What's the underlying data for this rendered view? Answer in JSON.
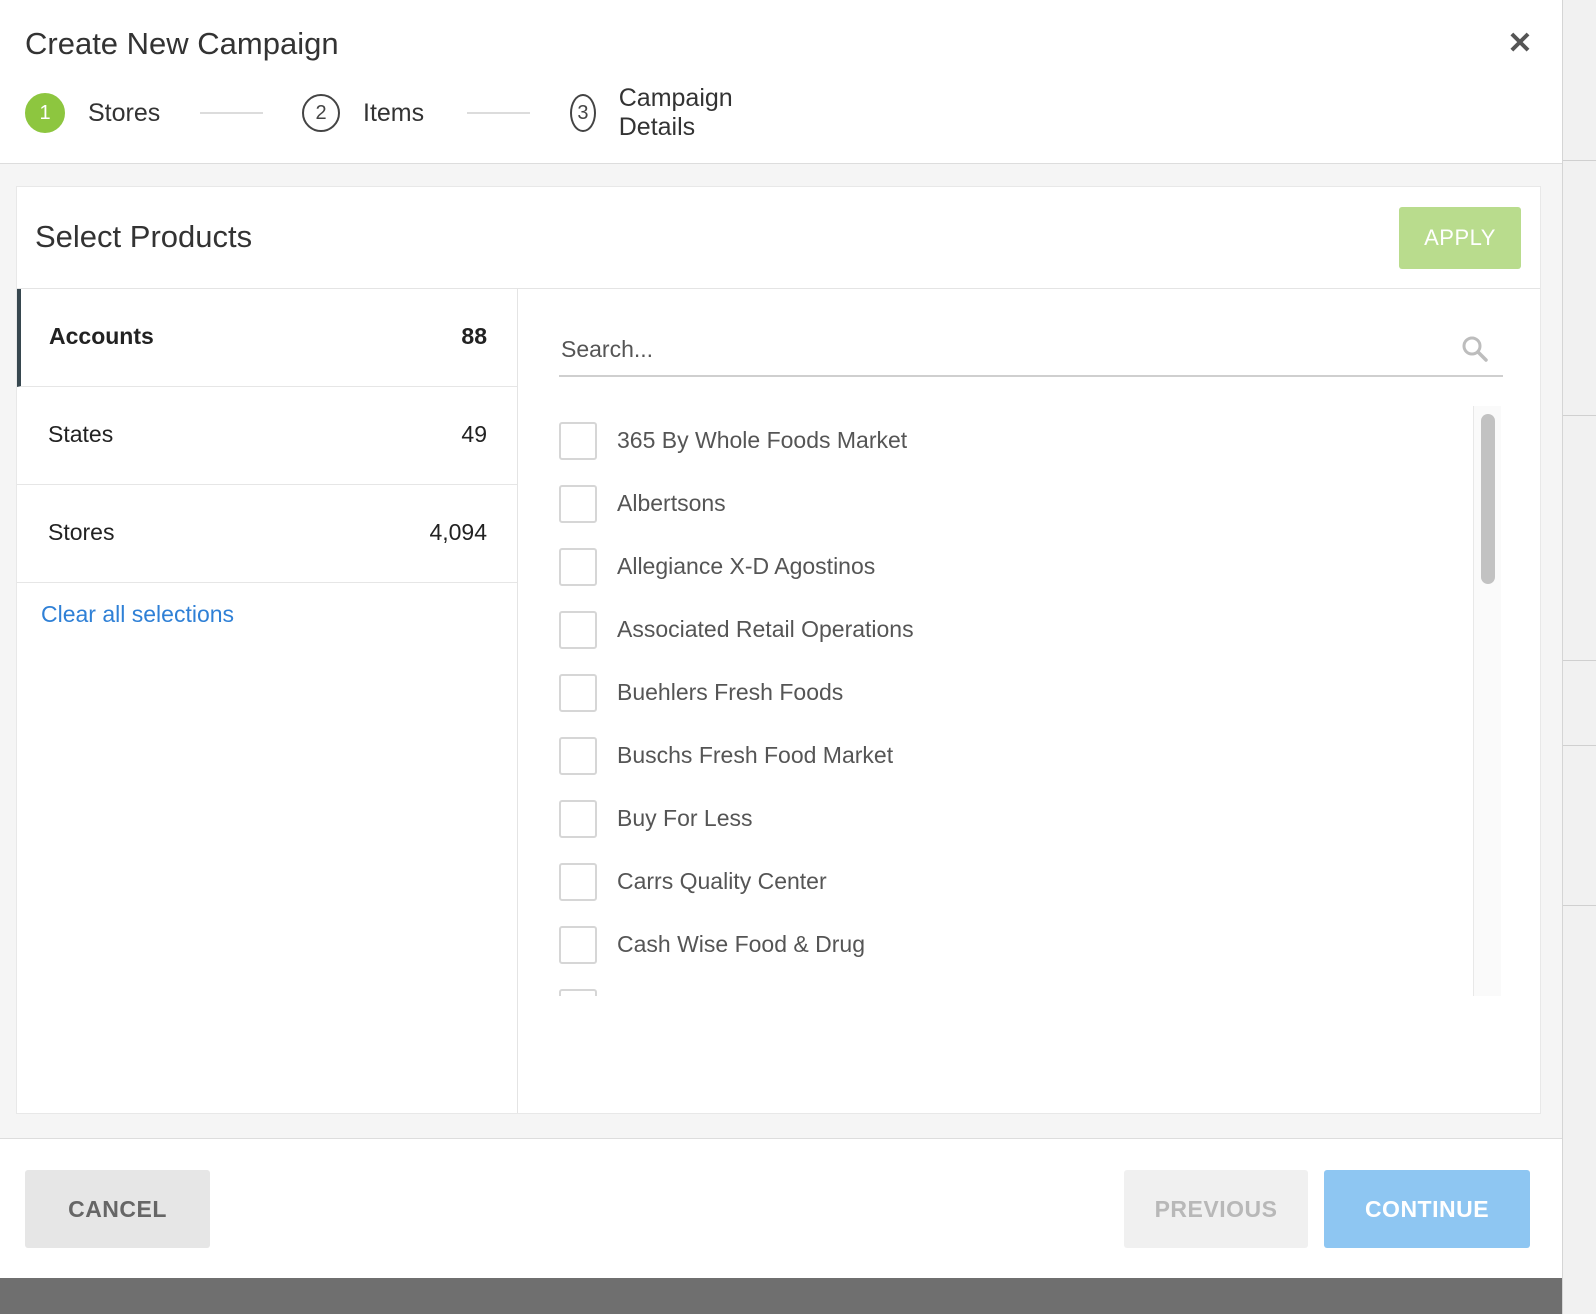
{
  "modal": {
    "title": "Create New Campaign",
    "close_icon": "close-icon",
    "close_glyph": "✕"
  },
  "stepper": {
    "steps": [
      {
        "number": "1",
        "label": "Stores",
        "active": true
      },
      {
        "number": "2",
        "label": "Items",
        "active": false
      },
      {
        "number": "3",
        "label": "Campaign Details",
        "active": false
      }
    ]
  },
  "card": {
    "title": "Select Products",
    "apply_label": "APPLY"
  },
  "facets": [
    {
      "label": "Accounts",
      "count": "88",
      "active": true
    },
    {
      "label": "States",
      "count": "49",
      "active": false
    },
    {
      "label": "Stores",
      "count": "4,094",
      "active": false
    }
  ],
  "clear_label": "Clear all selections",
  "search": {
    "placeholder": "Search...",
    "value": "",
    "icon": "search-icon"
  },
  "accounts": [
    {
      "label": "365 By Whole Foods Market",
      "checked": false
    },
    {
      "label": "Albertsons",
      "checked": false
    },
    {
      "label": "Allegiance X-D Agostinos",
      "checked": false
    },
    {
      "label": "Associated Retail Operations",
      "checked": false
    },
    {
      "label": "Buehlers Fresh Foods",
      "checked": false
    },
    {
      "label": "Buschs Fresh Food Market",
      "checked": false
    },
    {
      "label": "Buy For Less",
      "checked": false
    },
    {
      "label": "Carrs Quality Center",
      "checked": false
    },
    {
      "label": "Cash Wise Food & Drug",
      "checked": false
    }
  ],
  "footer": {
    "cancel_label": "CANCEL",
    "previous_label": "PREVIOUS",
    "continue_label": "CONTINUE"
  },
  "colors": {
    "step_active": "#8dc63f",
    "apply_bg": "#b9dc8d",
    "continue_bg": "#8ec6f2",
    "link": "#2f80d6",
    "facet_active_border": "#37474f"
  }
}
